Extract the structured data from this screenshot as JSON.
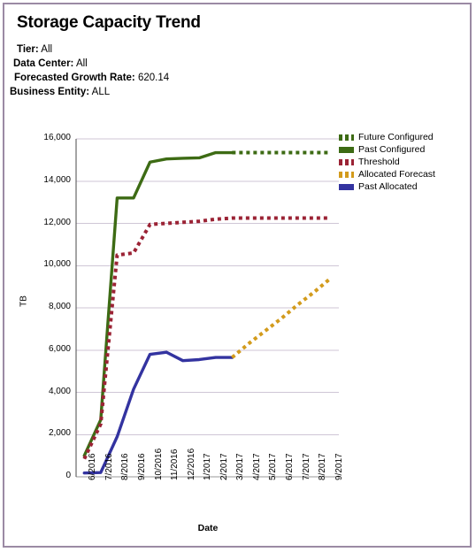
{
  "report": {
    "title": "Storage Capacity Trend",
    "params": [
      {
        "label": "Tier:",
        "value": "All"
      },
      {
        "label": "Data Center:",
        "value": "All"
      },
      {
        "label": "Forecasted Growth Rate:",
        "value": "620.14"
      },
      {
        "label": "Business Entity:",
        "value": "ALL"
      }
    ]
  },
  "colors": {
    "frame_border": "#9b8aa4",
    "future_configured": "#3d6b14",
    "past_configured": "#3d6b14",
    "threshold": "#9b2335",
    "allocated_forecast": "#d39b1c",
    "past_allocated": "#3333a0",
    "gridline": "#cfc6d6",
    "axis": "#6b6b6b"
  },
  "chart_data": {
    "type": "line",
    "title": "Storage Capacity Trend",
    "xlabel": "Date",
    "ylabel": "TB",
    "ylim": [
      0,
      16000
    ],
    "ytick_step": 2000,
    "yticks": [
      "0",
      "2,000",
      "4,000",
      "6,000",
      "8,000",
      "10,000",
      "12,000",
      "14,000",
      "16,000"
    ],
    "grid": true,
    "legend_position": "right-top",
    "categories": [
      "6/2016",
      "7/2016",
      "8/2016",
      "9/2016",
      "10/2016",
      "11/2016",
      "12/2016",
      "1/2017",
      "2/2017",
      "3/2017",
      "4/2017",
      "5/2017",
      "6/2017",
      "7/2017",
      "8/2017",
      "9/2017"
    ],
    "series": [
      {
        "name": "Past Configured",
        "style": "solid",
        "color": "#3d6b14",
        "values": [
          1000,
          2700,
          13200,
          13200,
          14900,
          15050,
          15080,
          15100,
          15350,
          15350,
          null,
          null,
          null,
          null,
          null,
          null
        ]
      },
      {
        "name": "Future Configured",
        "style": "dotted",
        "color": "#3d6b14",
        "values": [
          null,
          null,
          null,
          null,
          null,
          null,
          null,
          null,
          null,
          15350,
          15350,
          15350,
          15350,
          15350,
          15350,
          15350
        ]
      },
      {
        "name": "Threshold",
        "style": "dotted",
        "color": "#9b2335",
        "values": [
          850,
          2500,
          10500,
          10600,
          11950,
          12000,
          12050,
          12100,
          12200,
          12250,
          12250,
          12250,
          12250,
          12250,
          12250,
          12250
        ]
      },
      {
        "name": "Past Allocated",
        "style": "solid",
        "color": "#3333a0",
        "values": [
          180,
          200,
          1900,
          4150,
          5800,
          5900,
          5500,
          5550,
          5650,
          5650,
          null,
          null,
          null,
          null,
          null,
          null
        ]
      },
      {
        "name": "Allocated Forecast",
        "style": "dotted",
        "color": "#d39b1c",
        "values": [
          null,
          null,
          null,
          null,
          null,
          null,
          null,
          null,
          null,
          5650,
          6300,
          6900,
          7500,
          8150,
          8750,
          9400
        ]
      }
    ]
  },
  "legend": {
    "items": [
      {
        "label": "Future Configured",
        "color": "#3d6b14",
        "style": "dotted"
      },
      {
        "label": "Past Configured",
        "color": "#3d6b14",
        "style": "solid"
      },
      {
        "label": "Threshold",
        "color": "#9b2335",
        "style": "dotted"
      },
      {
        "label": "Allocated Forecast",
        "color": "#d39b1c",
        "style": "dotted"
      },
      {
        "label": "Past Allocated",
        "color": "#3333a0",
        "style": "solid"
      }
    ]
  }
}
